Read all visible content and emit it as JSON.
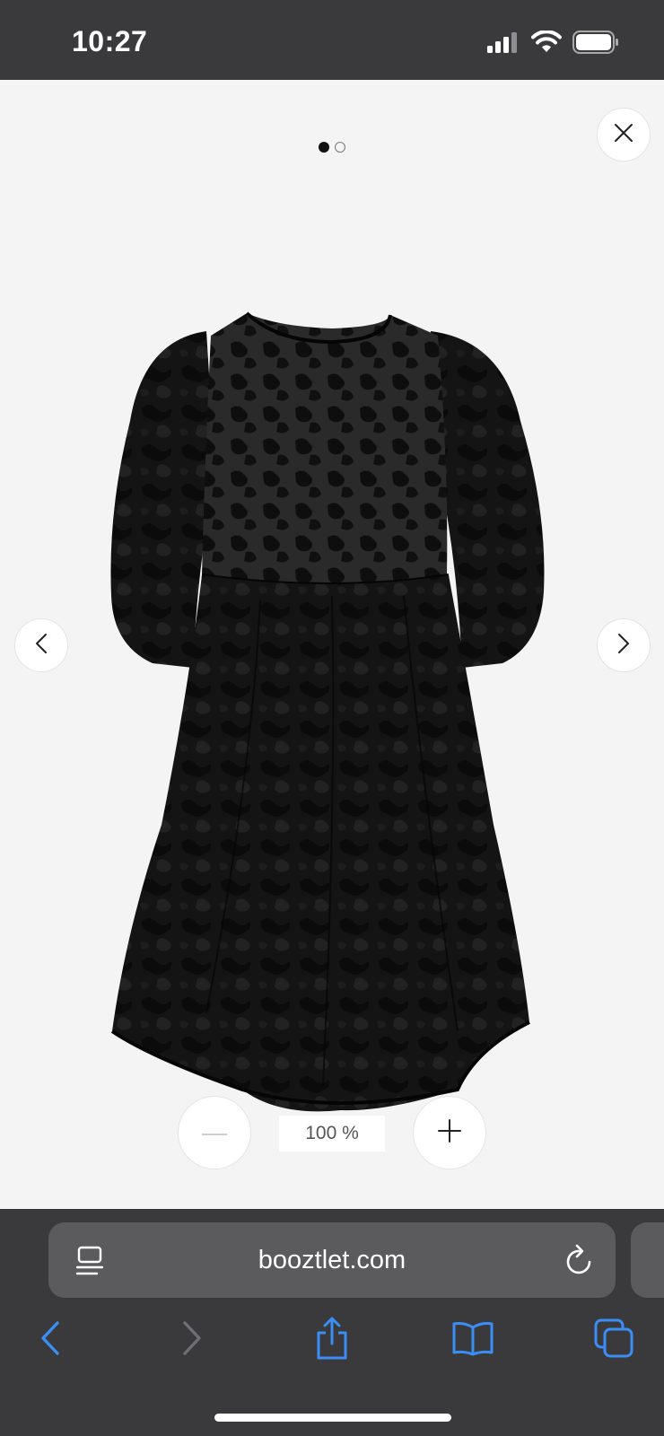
{
  "status_bar": {
    "time": "10:27",
    "icons": [
      "cellular-signal-icon",
      "wifi-icon",
      "battery-icon"
    ]
  },
  "viewer": {
    "pager": {
      "total": 2,
      "active_index": 0
    },
    "close_icon": "close-icon",
    "prev_icon": "chevron-left-icon",
    "next_icon": "chevron-right-icon",
    "image_subject": "black jacquard puff-sleeve mini dress",
    "zoom": {
      "level_text": "100 %",
      "decrease_icon": "minus-icon",
      "increase_icon": "plus-icon"
    }
  },
  "browser": {
    "url": "booztlet.com",
    "toolbar": [
      "back-icon",
      "forward-icon",
      "share-icon",
      "bookmarks-icon",
      "tabs-icon"
    ]
  },
  "colors": {
    "chrome_bg": "#3a3a3c",
    "address_bar_bg": "#5b5b5e",
    "viewer_bg": "#f4f4f4",
    "accent_blue": "#3a8ef6",
    "disabled_gray": "#6e6e73"
  }
}
